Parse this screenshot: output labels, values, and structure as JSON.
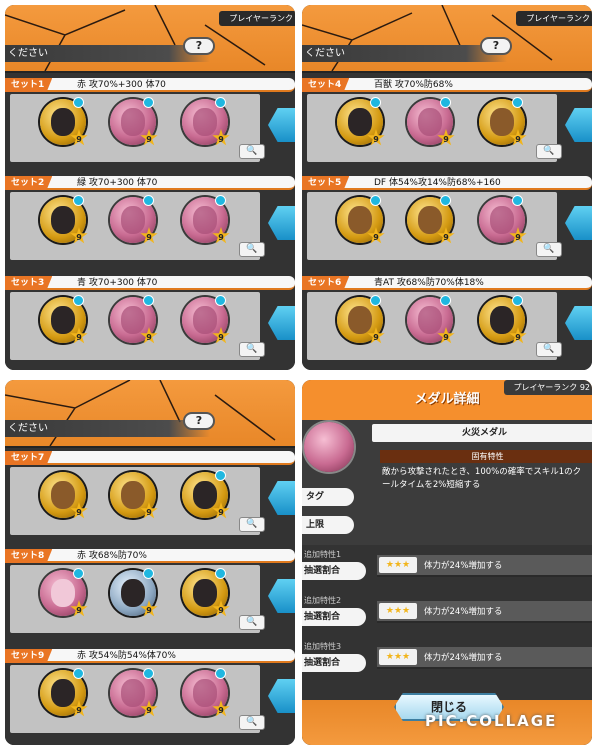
{
  "rank_label": "プレイヤーランク",
  "rank_label_short": "プレイヤーランク 92",
  "help_text": "ください",
  "help_button": "?",
  "sets": [
    {
      "tag": "セット1",
      "desc": "赤 攻70%+300 体70",
      "medals": [
        "gold",
        "pink",
        "pink"
      ],
      "levels": [
        "9",
        "9",
        "9"
      ]
    },
    {
      "tag": "セット2",
      "desc": "緑 攻70+300 体70",
      "medals": [
        "gold",
        "pink",
        "pink"
      ],
      "levels": [
        "9",
        "9",
        "9"
      ]
    },
    {
      "tag": "セット3",
      "desc": "青 攻70+300 体70",
      "medals": [
        "gold",
        "pink",
        "pink"
      ],
      "levels": [
        "9",
        "9",
        "9"
      ]
    },
    {
      "tag": "セット4",
      "desc": "百獣 攻70%防68%",
      "medals": [
        "gold",
        "pink",
        "gold"
      ],
      "levels": [
        "9",
        "9",
        "9"
      ]
    },
    {
      "tag": "セット5",
      "desc": "DF 体54%攻14%防68%+160",
      "medals": [
        "gold",
        "gold",
        "pink"
      ],
      "levels": [
        "9",
        "9",
        "9"
      ]
    },
    {
      "tag": "セット6",
      "desc": "青AT 攻68%防70%体18%",
      "medals": [
        "gold",
        "pink",
        "gold"
      ],
      "levels": [
        "9",
        "9",
        "9"
      ]
    },
    {
      "tag": "セット7",
      "desc": "",
      "medals": [
        "gold",
        "gold",
        "gold"
      ],
      "levels": [
        "9",
        "9",
        "9"
      ]
    },
    {
      "tag": "セット8",
      "desc": "赤 攻68%防70%",
      "medals": [
        "pink",
        "silver",
        "gold"
      ],
      "levels": [
        "9",
        "9",
        "9"
      ]
    },
    {
      "tag": "セット9",
      "desc": "赤 攻54%防54%体70%",
      "medals": [
        "gold",
        "pink",
        "pink"
      ],
      "levels": [
        "9",
        "9",
        "9"
      ]
    }
  ],
  "search_icon": "🔍",
  "detail": {
    "title": "メダル詳細",
    "medal_name": "火災メダル",
    "trait_header": "固有特性",
    "trait_text": "敵から攻撃されたとき、100%の確率でスキル1のクールタイムを2%短縮する",
    "tag_button": "タグ",
    "limit_button": "上限",
    "extras": [
      {
        "label": "追加特性1",
        "button": "抽選割合",
        "stars": "★★★",
        "text": "体力が24%増加する"
      },
      {
        "label": "追加特性2",
        "button": "抽選割合",
        "stars": "★★★",
        "text": "体力が24%増加する"
      },
      {
        "label": "追加特性3",
        "button": "抽選割合",
        "stars": "★★★",
        "text": "体力が24%増加する"
      }
    ],
    "close_button": "閉じる"
  },
  "watermark": "PIC·COLLAGE"
}
